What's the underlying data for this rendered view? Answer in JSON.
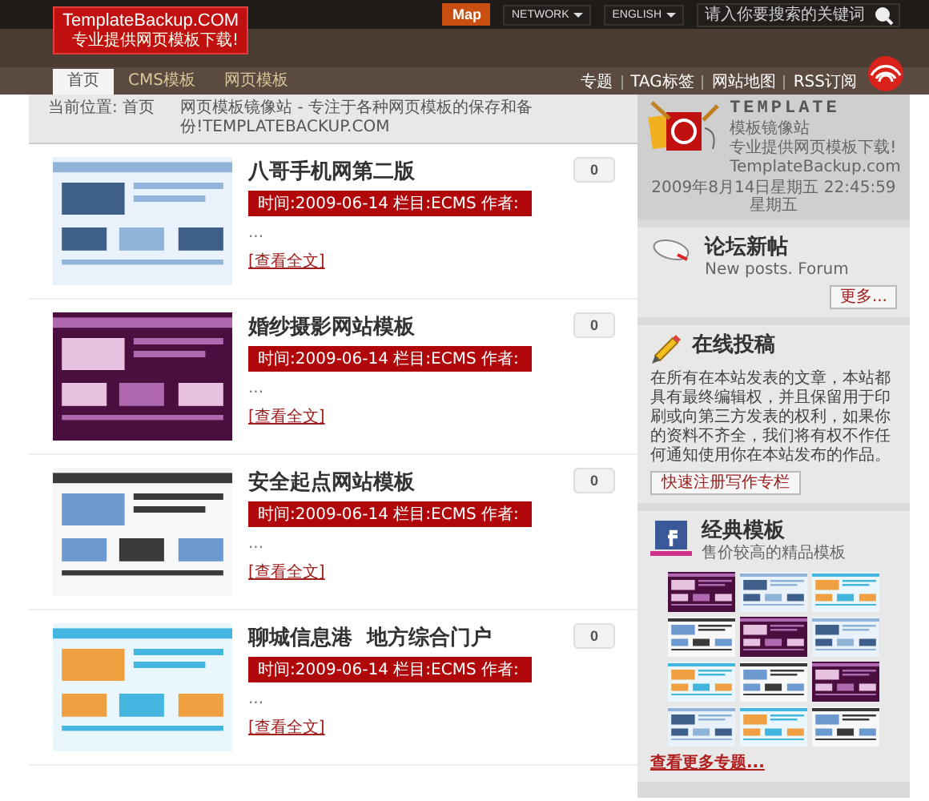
{
  "header": {
    "logo": {
      "title": "TemplateBackup.COM",
      "tagline": "专业提供网页模板下载!"
    },
    "map_button": "Map",
    "dropdowns": [
      "NETWORK",
      "ENGLISH"
    ],
    "search": {
      "placeholder": "请入你要搜索的关键词"
    }
  },
  "nav": {
    "tabs": [
      {
        "label": "首页",
        "selected": true
      },
      {
        "label": "CMS模板",
        "selected": false
      },
      {
        "label": "网页模板",
        "selected": false
      }
    ],
    "links": [
      "专题",
      "TAG标签",
      "网站地图",
      "RSS订阅"
    ]
  },
  "breadcrumb": {
    "location": "当前位置: 首页",
    "tagline": "网页模板镜像站 - 专注于各种网页模板的保存和备份!TEMPLATEBACKUP.COM"
  },
  "posts": [
    {
      "title": "八哥手机网第二版",
      "meta": "时间:2009-06-14 栏目:ECMS 作者:",
      "excerpt": "...",
      "read_more": "[查看全文]",
      "comments": "0"
    },
    {
      "title": "婚纱摄影网站模板",
      "meta": "时间:2009-06-14 栏目:ECMS 作者:",
      "excerpt": "...",
      "read_more": "[查看全文]",
      "comments": "0"
    },
    {
      "title": "安全起点网站模板",
      "meta": "时间:2009-06-14 栏目:ECMS 作者:",
      "excerpt": "...",
      "read_more": "[查看全文]",
      "comments": "0"
    },
    {
      "title": "聊城信息港  地方综合门户",
      "meta": "时间:2009-06-14 栏目:ECMS 作者:",
      "excerpt": "...",
      "read_more": "[查看全文]",
      "comments": "0"
    }
  ],
  "sidebar": {
    "template_widget": {
      "heading": "TEMPLATE",
      "lines": [
        "模板镜像站",
        "专业提供网页模板下载!",
        "TemplateBackup.com"
      ],
      "date": "2009年8月14日星期五 22:45:59 星期五"
    },
    "forum": {
      "title": "论坛新帖",
      "subtitle": "New posts. Forum",
      "more_button": "更多..."
    },
    "submit": {
      "title": "在线投稿",
      "text": "在所有在本站发表的文章，本站都具有最终编辑权，并且保留用于印刷或向第三方发表的权利，如果你的资料不齐全，我们将有权不作任何通知使用你在本站发布的作品。",
      "button": "快速注册写作专栏"
    },
    "classic": {
      "title": "经典模板",
      "subtitle": "售价较高的精品模板",
      "link": "查看更多专题..."
    }
  }
}
